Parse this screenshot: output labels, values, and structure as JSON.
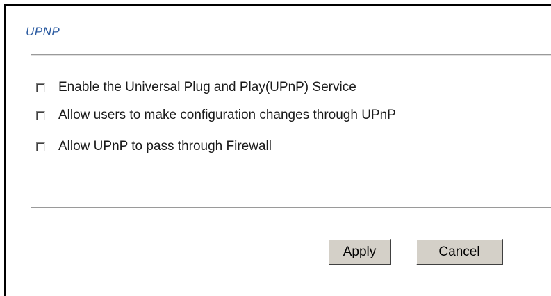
{
  "section": {
    "title": "UPNP"
  },
  "options": [
    {
      "label": "Enable the Universal Plug and Play(UPnP) Service",
      "checked": false
    },
    {
      "label": "Allow users to make configuration changes through UPnP",
      "checked": false
    },
    {
      "label": "Allow UPnP to pass through Firewall",
      "checked": false
    }
  ],
  "buttons": {
    "apply": "Apply",
    "cancel": "Cancel"
  }
}
